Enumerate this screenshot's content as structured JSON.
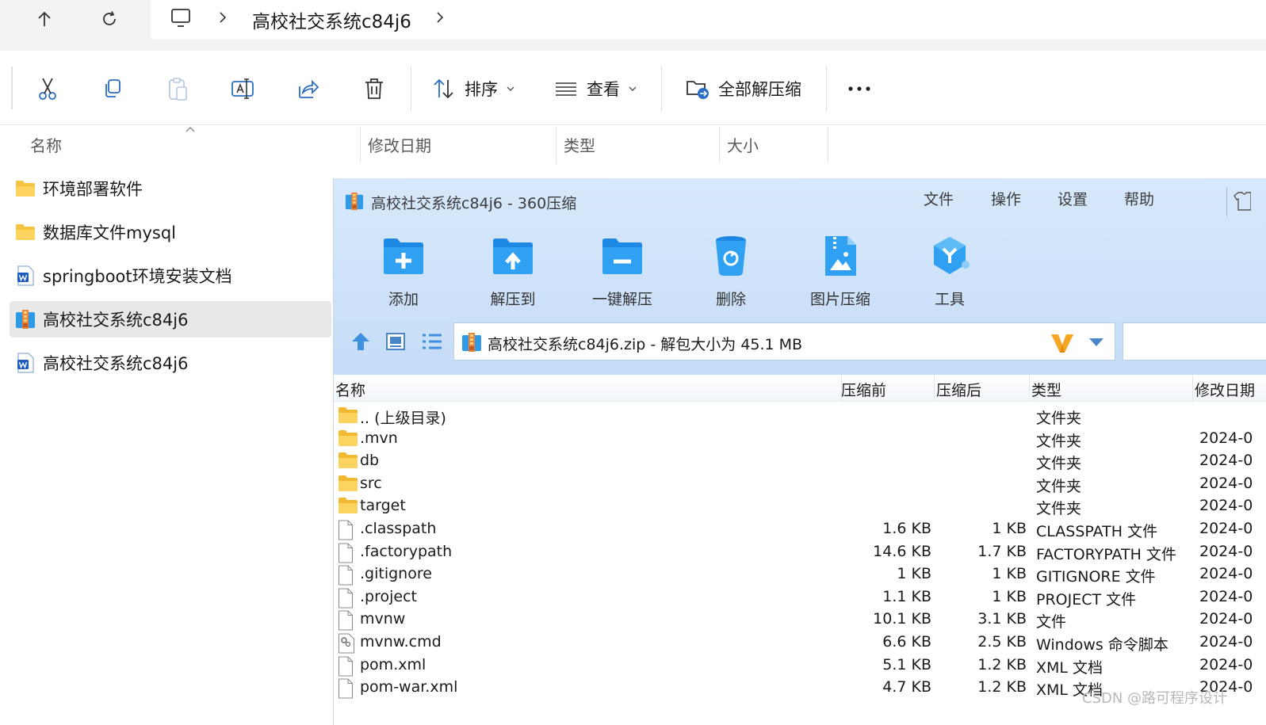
{
  "explorer": {
    "breadcrumb": [
      "高校社交系统c84j6"
    ],
    "commands": {
      "sort_label": "排序",
      "view_label": "查看",
      "extract_all_label": "全部解压缩"
    },
    "columns": {
      "name": "名称",
      "modified": "修改日期",
      "type": "类型",
      "size": "大小"
    },
    "files": [
      {
        "name": "环境部署软件",
        "icon": "folder-icon"
      },
      {
        "name": "数据库文件mysql",
        "icon": "folder-icon"
      },
      {
        "name": "springboot环境安装文档",
        "icon": "word-document-icon"
      },
      {
        "name": "高校社交系统c84j6",
        "icon": "zip-archive-icon",
        "selected": true
      },
      {
        "name": "高校社交系统c84j6",
        "icon": "word-document-icon"
      }
    ]
  },
  "zip_app": {
    "title": "高校社交系统c84j6 - 360压缩",
    "menu": [
      "文件",
      "操作",
      "设置",
      "帮助"
    ],
    "tools": [
      "添加",
      "解压到",
      "一键解压",
      "删除",
      "图片压缩",
      "工具"
    ],
    "path": "高校社交系统c84j6.zip - 解包大小为 45.1 MB",
    "columns": {
      "name": "名称",
      "before": "压缩前",
      "after": "压缩后",
      "type": "类型",
      "modified": "修改日期"
    },
    "rows": [
      {
        "name": ".. (上级目录)",
        "icon": "folder-icon",
        "before": "",
        "after": "",
        "type": "文件夹",
        "date": ""
      },
      {
        "name": ".mvn",
        "icon": "folder-icon",
        "before": "",
        "after": "",
        "type": "文件夹",
        "date": "2024-0"
      },
      {
        "name": "db",
        "icon": "folder-icon",
        "before": "",
        "after": "",
        "type": "文件夹",
        "date": "2024-0"
      },
      {
        "name": "src",
        "icon": "folder-icon",
        "before": "",
        "after": "",
        "type": "文件夹",
        "date": "2024-0"
      },
      {
        "name": "target",
        "icon": "folder-icon",
        "before": "",
        "after": "",
        "type": "文件夹",
        "date": "2024-0"
      },
      {
        "name": ".classpath",
        "icon": "file-icon",
        "before": "1.6 KB",
        "after": "1 KB",
        "type": "CLASSPATH 文件",
        "date": "2024-0"
      },
      {
        "name": ".factorypath",
        "icon": "file-icon",
        "before": "14.6 KB",
        "after": "1.7 KB",
        "type": "FACTORYPATH 文件",
        "date": "2024-0"
      },
      {
        "name": ".gitignore",
        "icon": "file-icon",
        "before": "1 KB",
        "after": "1 KB",
        "type": "GITIGNORE 文件",
        "date": "2024-0"
      },
      {
        "name": ".project",
        "icon": "file-icon",
        "before": "1.1 KB",
        "after": "1 KB",
        "type": "PROJECT 文件",
        "date": "2024-0"
      },
      {
        "name": "mvnw",
        "icon": "file-icon",
        "before": "10.1 KB",
        "after": "3.1 KB",
        "type": "文件",
        "date": "2024-0"
      },
      {
        "name": "mvnw.cmd",
        "icon": "script-file-icon",
        "before": "6.6 KB",
        "after": "2.5 KB",
        "type": "Windows 命令脚本",
        "date": "2024-0"
      },
      {
        "name": "pom.xml",
        "icon": "file-icon",
        "before": "5.1 KB",
        "after": "1.2 KB",
        "type": "XML 文档",
        "date": "2024-0"
      },
      {
        "name": "pom-war.xml",
        "icon": "file-icon",
        "before": "4.7 KB",
        "after": "1.2 KB",
        "type": "XML 文档",
        "date": "2024-0"
      }
    ]
  },
  "watermark": "CSDN @路可程序设计",
  "colors": {
    "zip_header_bg": "#c6ddf8",
    "folder_yellow": "#f7c343",
    "zip_blue": "#2f9be8",
    "word_blue": "#1f5bbf"
  }
}
